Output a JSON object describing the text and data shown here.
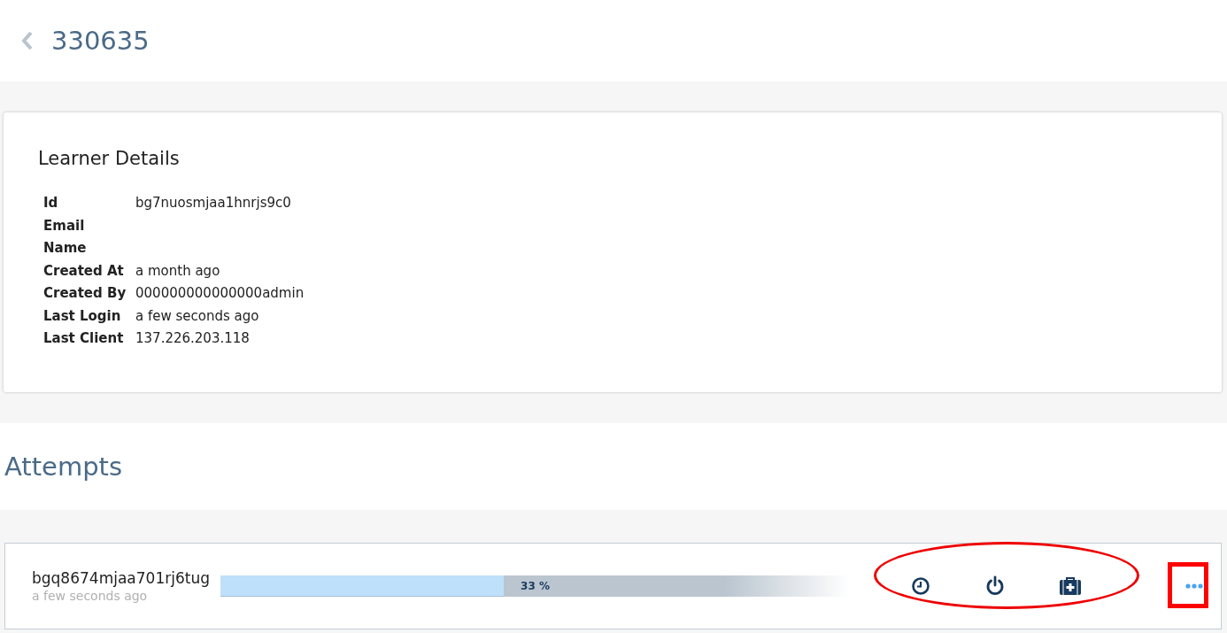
{
  "header": {
    "title": "330635"
  },
  "learner_details": {
    "title": "Learner Details",
    "fields": [
      {
        "label": "Id",
        "value": "bg7nuosmjaa1hnrjs9c0"
      },
      {
        "label": "Email"
      },
      {
        "label": "Name"
      },
      {
        "label": "Created At",
        "value": "a month ago"
      },
      {
        "label": "Created By",
        "value": "000000000000000admin"
      },
      {
        "label": "Last Login",
        "value": "a few seconds ago"
      },
      {
        "label": "Last Client",
        "value": "137.226.203.118"
      }
    ]
  },
  "attempts": {
    "title": "Attempts",
    "items": [
      {
        "id": "bgq8674mjaa701rj6tug",
        "time": "a few seconds ago",
        "level": 0.45,
        "reading": "33 %"
      }
    ]
  },
  "annotations": [
    {
      "kind": "ellipse"
    },
    {
      "kind": "rectangle"
    }
  ]
}
